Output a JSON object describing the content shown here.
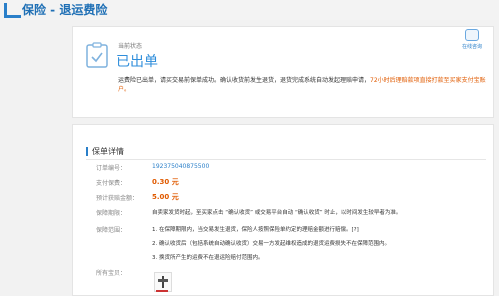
{
  "header": {
    "title": "保险 - 退运费险"
  },
  "status": {
    "caption": "当前状态",
    "value": "已出单",
    "desc_prefix": "运费险已出单，请买交易前保单成功。确认收货前发生退货，退货完成系统自动发起理赔申请，",
    "desc_highlight": "72小时后理赔款项直接打款至买家支付宝账户。"
  },
  "service": {
    "label": "在线咨询"
  },
  "detail": {
    "title": "保单详情",
    "rows": [
      {
        "label": "订单编号：",
        "value": "192375040875500"
      },
      {
        "label": "支付保费：",
        "value": "0.30 元"
      },
      {
        "label": "预计获赔金额：",
        "value": "5.00 元"
      },
      {
        "label": "保障期限：",
        "value": "自卖家发货时起，至买家点击 “确认收货” 或交易平台自动 “确认收货” 时止，以时间发生较早者为准。"
      },
      {
        "label": "保障范围：",
        "value": "1. 在保障期限内，当交易发生退货，保险人按照保险单约定的理赔金额进行赔偿。[?]"
      }
    ],
    "scope_items": [
      "2. 确认收货后（包括系统自动确认收货）交易一方发起维权造成的退货运费损失不在保障范围内。",
      "3. 换货所产生的运费不在退运险赔付范围内。"
    ],
    "products_label": "所有宝贝："
  },
  "colors": {
    "accent": "#2a7fc9",
    "status": "#2f8edb",
    "amount": "#e05a00"
  },
  "icons": [
    "shield-check-icon",
    "chat-icon"
  ]
}
